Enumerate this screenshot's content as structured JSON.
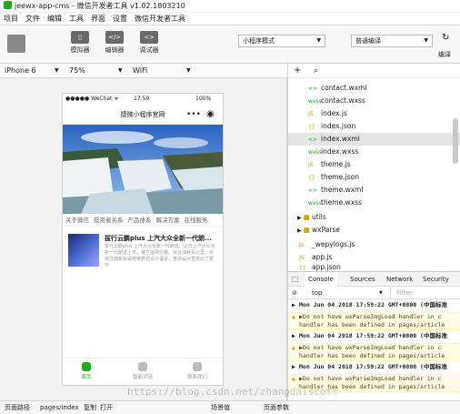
{
  "window": {
    "title": "jeewx-app-cms - 微信开发者工具 v1.02.1803210"
  },
  "menu": [
    "项目",
    "文件",
    "编辑",
    "工具",
    "界面",
    "设置",
    "微信开发者工具"
  ],
  "toolbar": {
    "buttons": [
      {
        "icon": "phone-icon",
        "label": "模拟器"
      },
      {
        "icon": "code-icon",
        "label": "编辑器"
      },
      {
        "icon": "debug-icon",
        "label": "调试器"
      }
    ],
    "mode_select": "小程序模式",
    "compile_select": "普通编译",
    "right_label": "编译"
  },
  "options": {
    "device": "iPhone 6",
    "zoom": "75%",
    "network": "WiFi"
  },
  "phone": {
    "status_left": "●●●●● WeChat ᯤ",
    "status_time": "17:59",
    "status_right": "100%",
    "nav_title": "捷微小程序官网",
    "tabs": [
      "关于微信",
      "投资者关系",
      "产品体系",
      "解决方案",
      "在线服务"
    ],
    "article_title": "拔行云鹏plus 上汽大众全新一代朗...",
    "article_desc": "拔行云鹏plus 上汽大众全新一代朗逸。近日上汽大众全新一代朗逸上市，官方指导价格。综合油耗百公里，外观方面新车采用家族式设计语言，宽体设计营造出了更加。",
    "tabbar": [
      "首页",
      "智能对话",
      "联系我们"
    ]
  },
  "files": {
    "items": [
      {
        "icon": "<>",
        "type": "wx",
        "name": "contact.wxml"
      },
      {
        "icon": "wxss",
        "type": "wx",
        "name": "contact.wxss"
      },
      {
        "icon": "JS",
        "type": "js",
        "name": "index.js"
      },
      {
        "icon": "{}",
        "type": "js",
        "name": "index.json"
      },
      {
        "icon": "<>",
        "type": "wx",
        "name": "index.wxml"
      },
      {
        "icon": "wxss",
        "type": "wx",
        "name": "index.wxss"
      },
      {
        "icon": "JS",
        "type": "js",
        "name": "theme.js"
      },
      {
        "icon": "{}",
        "type": "js",
        "name": "theme.json"
      },
      {
        "icon": "<>",
        "type": "wx",
        "name": "theme.wxml"
      },
      {
        "icon": "wxss",
        "type": "wx",
        "name": "theme.wxss"
      }
    ],
    "folders": [
      "utils",
      "wxParse"
    ],
    "after": [
      {
        "icon": "JS",
        "type": "js",
        "name": "_wepylogs.js"
      },
      {
        "icon": "JS",
        "type": "js",
        "name": "app.js"
      },
      {
        "icon": "{}",
        "type": "js",
        "name": "app.json"
      }
    ]
  },
  "devtools": {
    "tabs": [
      "Console",
      "Sources",
      "Network",
      "Security"
    ],
    "context": "top",
    "filter_placeholder": "Filter",
    "logs": [
      {
        "kind": "info",
        "text": "Mon Jun 04 2018 17:59:22 GMT+0800 (中国标准"
      },
      {
        "kind": "warn",
        "text": "▶Do not have wxParseImgLoad handler in c",
        "text2": "handler has been defined in pages/article"
      },
      {
        "kind": "info",
        "text": "Mon Jun 04 2018 17:59:22 GMT+0800 (中国标准"
      },
      {
        "kind": "warn",
        "text": "▶Do not have wxParseImgLoad handler in c",
        "text2": "handler has been defined in pages/article"
      },
      {
        "kind": "info",
        "text": "Mon Jun 04 2018 17:59:22 GMT+0800 (中国标准"
      },
      {
        "kind": "warn",
        "text": "▶Do not have wxParseImgLoad handler in c",
        "text2": "handler has been defined in pages/article"
      }
    ]
  },
  "statusbar": {
    "path_label": "页面路径",
    "path": "pages/index",
    "copy": "复制",
    "open": "打开",
    "scene": "场景值",
    "params": "页面参数"
  },
  "watermark": "https://blog.csdn.net/zhangdaiscott"
}
